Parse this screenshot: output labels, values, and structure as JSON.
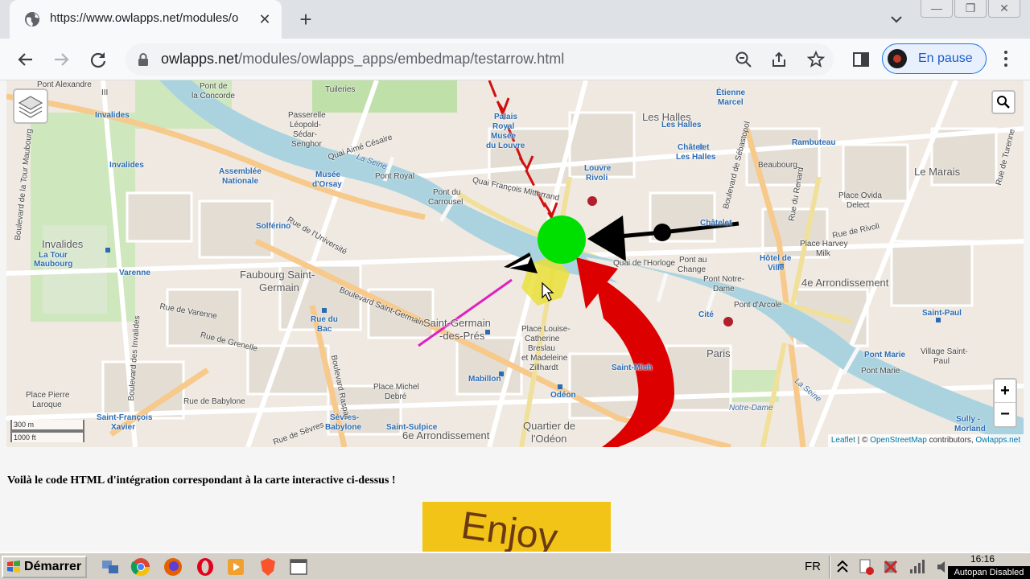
{
  "browser": {
    "tab_title": "https://www.owlapps.net/modules/o",
    "url_host": "owlapps.net",
    "url_path": "/modules/owlapps_apps/embedmap/testarrow.html",
    "profile_label": "En pause"
  },
  "map": {
    "labels": {
      "pont_alexandre": "Pont Alexandre",
      "iii": "III",
      "pont_concorde_1": "Pont de",
      "pont_concorde_2": "la Concorde",
      "tuileries": "Tuileries",
      "passerelle_1": "Passerelle",
      "passerelle_2": "Léopold-",
      "passerelle_3": "Sédar-",
      "passerelle_4": "Senghor",
      "quai_aime_cesaire": "Quai Aimé Césaire",
      "invalides_1": "Invalides",
      "invalides_2": "Invalides",
      "invalides_big": "Invalides",
      "la_tour_maubourg_1": "La Tour",
      "la_tour_maubourg_2": "Maubourg",
      "assemblee_1": "Assemblée",
      "assemblee_2": "Nationale",
      "musee_orsay_1": "Musée",
      "musee_orsay_2": "d'Orsay",
      "pont_royal": "Pont Royal",
      "pont_carrousel_1": "Pont du",
      "pont_carrousel_2": "Carrousel",
      "quai_francois_mitterrand": "Quai François Mitterrand",
      "palais_royal_1": "Palais",
      "palais_royal_2": "Royal",
      "palais_royal_3": "Musée",
      "palais_royal_4": "du Louvre",
      "louvre_rivoli_1": "Louvre",
      "louvre_rivoli_2": "Rivoli",
      "les_halles_1": "Les Halles",
      "les_halles_2": "Les Halles",
      "chatelet_les_halles_1": "Châtelet",
      "chatelet_les_halles_2": "Les Halles",
      "etienne_marcel_1": "Étienne",
      "etienne_marcel_2": "Marcel",
      "rambuteau": "Rambuteau",
      "le_marais": "Le Marais",
      "beaubourg": "Beaubourg",
      "place_ovida_1": "Place Ovida",
      "place_ovida_2": "Delect",
      "place_harvey_1": "Place Harvey",
      "place_harvey_2": "Milk",
      "hotel_de_ville_1": "Hôtel de",
      "hotel_de_ville_2": "Ville",
      "chatelet": "Châtelet",
      "pont_au_change_1": "Pont au",
      "pont_au_change_2": "Change",
      "notre_dame_1": "Pont Notre-",
      "notre_dame_2": "Dame",
      "arrondissement_4": "4e Arrondissement",
      "pont_darcole": "Pont d'Arcole",
      "cite": "Cité",
      "paris": "Paris",
      "saint_paul": "Saint-Paul",
      "pont_marie_1": "Pont Marie",
      "pont_marie_2": "Pont Marie",
      "village_saint_paul_1": "Village Saint-",
      "village_saint_paul_2": "Paul",
      "sully_morland_1": "Sully -",
      "sully_morland_2": "Morland",
      "faubourg_1": "Faubourg Saint-",
      "faubourg_2": "Germain",
      "solferino": "Solférino",
      "varenne": "Varenne",
      "rue_du_bac_1": "Rue du",
      "rue_du_bac_2": "Bac",
      "saint_germain_1": "Saint-Germain",
      "saint_germain_2": "-des-Prés",
      "place_louise_1": "Place Louise-",
      "place_louise_2": "Catherine",
      "place_louise_3": "Breslau",
      "place_louise_4": "et Madeleine",
      "place_louise_5": "Zillhardt",
      "mabillon": "Mabillon",
      "odeon": "Odéon",
      "saint_michel": "Saint-Mich",
      "quartier_odeon_1": "Quartier de",
      "quartier_odeon_2": "l'Odéon",
      "arr_6": "6e Arrondissement",
      "saint_sulpice": "Saint-Sulpice",
      "place_michel_debre_1": "Place Michel",
      "place_michel_debre_2": "Debré",
      "place_pierre_1": "Place Pierre",
      "place_pierre_2": "Laroque",
      "saint_francois_1": "Saint-François",
      "saint_francois_2": "Xavier",
      "sevres_1": "Sèvres-",
      "sevres_2": "Babylone",
      "la_seine_1": "La Seine",
      "la_seine_2": "La Seine",
      "notre_dame_w": "Notre-Dame",
      "boulevard_saint_germain": "Boulevard Saint-Germain",
      "boulevard_raspail": "Boulevard Raspail",
      "boulevard_sebastopol": "Boulevard de Sébastopol",
      "boulevard_invalides": "Boulevard des Invalides",
      "rue_de_varenne": "Rue de Varenne",
      "rue_de_luniversite": "Rue de l'Université",
      "rue_de_grenelle": "Rue de Grenelle",
      "rue_de_sevres": "Rue de Sèvres",
      "quai_de_lhorloge": "Quai de l'Horloge",
      "rue_de_babylone": "Rue de Babylone",
      "rue_de_rivoli": "Rue de Rivoli",
      "rue_du_renard": "Rue du Renard",
      "rue_de_turenne": "Rue de Turenne",
      "boulevard_de_la_tour_maubourg": "Boulevard de la Tour Maubourg"
    },
    "scale_m": "300 m",
    "scale_ft": "1000 ft",
    "attribution_leaflet": "Leaflet",
    "attribution_sep": " | © ",
    "attribution_osm": "OpenStreetMap",
    "attribution_contrib": " contributors, ",
    "attribution_owl": "Owlapps.net",
    "zoom_in": "+",
    "zoom_out": "−"
  },
  "page": {
    "text": "Voilà le code HTML d'intégration correspondant à la carte interactive ci-dessus !",
    "banner_text": "Enjoy"
  },
  "taskbar": {
    "start_label": "Démarrer",
    "lang": "FR",
    "clock": "16:16",
    "autopan": "Autopan Disabled"
  }
}
